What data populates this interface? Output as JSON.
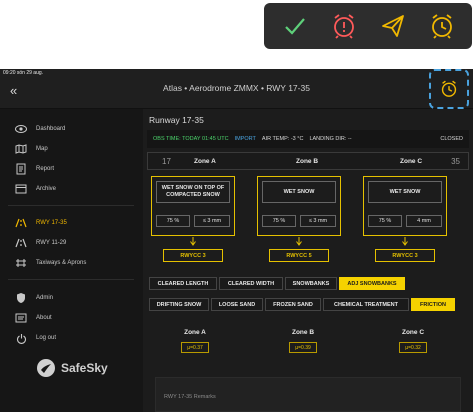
{
  "toolbar": {
    "icons": [
      "check-icon",
      "alarm-alert-icon",
      "send-icon",
      "alarm-clock-icon"
    ],
    "colors": {
      "check": "#5ed07a",
      "alarm_alert": "#ff5a5a",
      "send": "#f1b800",
      "alarm_clock": "#f1b800"
    }
  },
  "status": {
    "time": "09:20",
    "date": "sön 29 aug."
  },
  "header": {
    "title": "Atlas • Aerodrome ZMMX • RWY 17-35"
  },
  "sidebar": {
    "items": [
      {
        "label": "Dashboard",
        "icon": "eye-icon"
      },
      {
        "label": "Map",
        "icon": "map-icon"
      },
      {
        "label": "Report",
        "icon": "report-icon"
      },
      {
        "label": "Archive",
        "icon": "archive-icon"
      },
      {
        "label": "RWY 17-35",
        "icon": "runway-icon"
      },
      {
        "label": "RWY 11-29",
        "icon": "runway-icon"
      },
      {
        "label": "Taxiways & Aprons",
        "icon": "taxiway-icon"
      },
      {
        "label": "Admin",
        "icon": "shield-icon"
      },
      {
        "label": "About",
        "icon": "about-icon"
      },
      {
        "label": "Log out",
        "icon": "power-icon"
      }
    ],
    "active": "RWY 17-35",
    "logo": "SafeSky"
  },
  "main": {
    "runway_title": "Runway 17-35",
    "obs_time": "OBS TIME: TODAY 01:45 UTC",
    "import_label": "IMPORT",
    "air_temp": "AIR TEMP: -3 °C",
    "landing_dir": "LANDING DIR: --",
    "closed_label": "CLOSED",
    "rwy_left": "17",
    "rwy_right": "35",
    "zones": [
      {
        "name": "Zone A",
        "condition": "WET SNOW ON TOP OF COMPACTED SNOW",
        "coverage": "75 %",
        "depth": "≤ 3 mm",
        "rwycc": "RWYCC 3",
        "mu": "µ=0.37"
      },
      {
        "name": "Zone B",
        "condition": "WET SNOW",
        "coverage": "75 %",
        "depth": "≤ 3 mm",
        "rwycc": "RWYCC 5",
        "mu": "µ=0.39"
      },
      {
        "name": "Zone C",
        "condition": "WET SNOW",
        "coverage": "75 %",
        "depth": "4 mm",
        "rwycc": "RWYCC 3",
        "mu": "µ=0.32"
      }
    ],
    "chips_row1": [
      {
        "label": "CLEARED LENGTH",
        "active": false
      },
      {
        "label": "CLEARED WIDTH",
        "active": false
      },
      {
        "label": "SNOWBANKS",
        "active": false
      },
      {
        "label": "ADJ SNOWBANKS",
        "active": true
      }
    ],
    "chips_row2": [
      {
        "label": "DRIFTING SNOW",
        "active": false
      },
      {
        "label": "LOOSE SAND",
        "active": false
      },
      {
        "label": "FROZEN SAND",
        "active": false
      },
      {
        "label": "CHEMICAL TREATMENT",
        "active": false
      },
      {
        "label": "FRICTION",
        "active": true
      }
    ],
    "remarks_placeholder": "RWY 17-35 Remarks"
  }
}
